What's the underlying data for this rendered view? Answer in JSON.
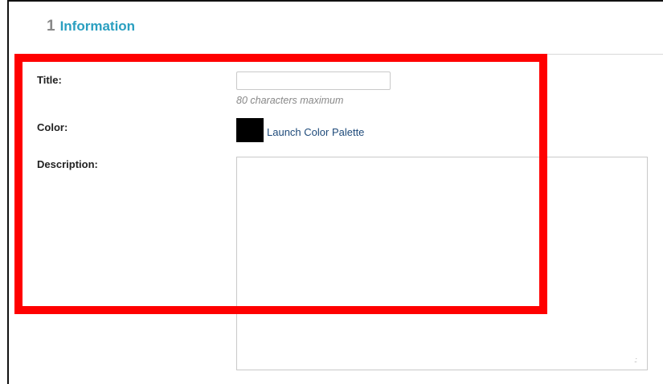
{
  "section": {
    "number": "1",
    "title": "Information"
  },
  "form": {
    "title_label": "Title:",
    "title_value": "",
    "title_hint": "80 characters maximum",
    "color_label": "Color:",
    "color_value": "#000000",
    "color_link": "Launch Color Palette",
    "description_label": "Description:",
    "description_value": ""
  },
  "colors": {
    "section_title": "#2a9fc0",
    "link": "#1e4a7a",
    "highlight": "#ff0000"
  },
  "icons": {
    "resize": "resize-grip-icon"
  }
}
